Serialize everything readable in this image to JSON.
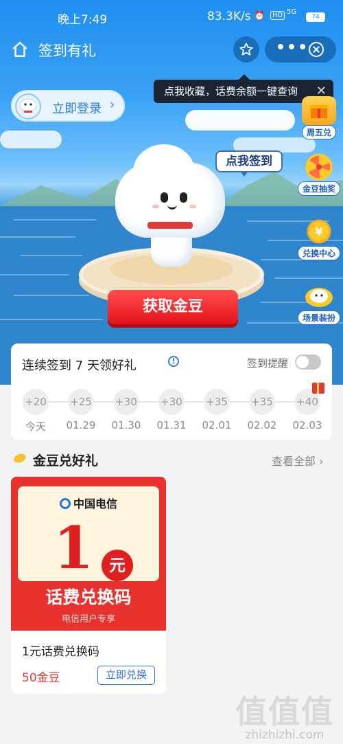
{
  "status_bar": {
    "time": "晚上7:49",
    "speed": "83.3K/s",
    "hd": "HD",
    "network": "5G",
    "battery": "74"
  },
  "header": {
    "title": "签到有礼",
    "home_icon": "home-icon",
    "star_icon": "star-icon",
    "more_icon": "more-icon",
    "close_icon": "close-icon"
  },
  "tooltip": {
    "text": "点我收藏，话费余额一键查询",
    "close": "✕"
  },
  "login": {
    "label": "立即登录",
    "chevron": "›"
  },
  "hero": {
    "sign_bubble": "点我签到",
    "get_button": "获取金豆"
  },
  "float_menu": [
    {
      "label": "周五兑",
      "icon": "gift-box-icon"
    },
    {
      "label": "金豆抽奖",
      "icon": "prize-wheel-icon"
    },
    {
      "label": "兑换中心",
      "icon": "coin-icon"
    },
    {
      "label": "场景装扮",
      "icon": "mascot-icon"
    }
  ],
  "checkin": {
    "title": "连续签到 7 天领好礼",
    "info": "!",
    "reminder_label": "签到提醒",
    "reminder_on": false,
    "days": [
      {
        "points": "+20",
        "date": "今天"
      },
      {
        "points": "+25",
        "date": "01.29"
      },
      {
        "points": "+30",
        "date": "01.30"
      },
      {
        "points": "+30",
        "date": "01.31"
      },
      {
        "points": "+35",
        "date": "02.01"
      },
      {
        "points": "+35",
        "date": "02.02"
      },
      {
        "points": "+40",
        "date": "02.03"
      }
    ]
  },
  "section": {
    "title": "金豆兑好礼",
    "see_all": "查看全部 ›"
  },
  "product": {
    "brand": "中国电信",
    "amount": "1",
    "unit": "元",
    "coupon_title": "话费兑换码",
    "coupon_sub": "电信用户专享",
    "name": "1元话费兑换码",
    "price": "50金豆",
    "button": "立即兑换"
  },
  "watermark": {
    "mark": "值值值",
    "text": "zhizhizhi.com"
  },
  "colors": {
    "primary_blue": "#1f8ef0",
    "accent_red": "#e53935",
    "page_bg": "#f2f3f5"
  }
}
